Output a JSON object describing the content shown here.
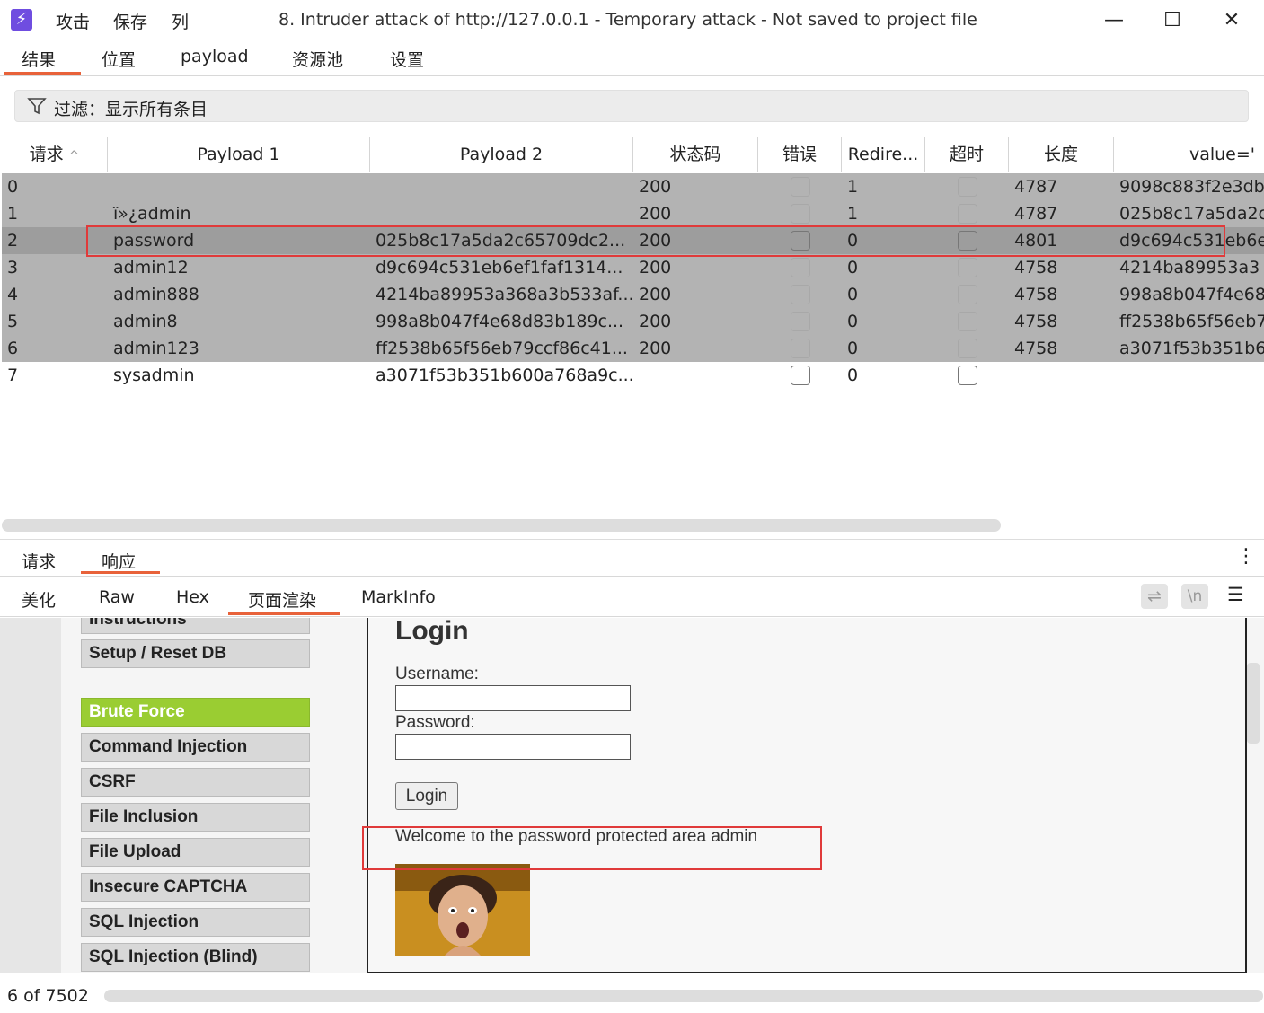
{
  "window": {
    "title": "8. Intruder attack of http://127.0.0.1 - Temporary attack - Not saved to project file",
    "menu": [
      "攻击",
      "保存",
      "列"
    ],
    "controls": {
      "minimize": "—",
      "maximize": "☐",
      "close": "✕"
    }
  },
  "top_tabs": [
    "结果",
    "位置",
    "payload",
    "资源池",
    "设置"
  ],
  "filter": {
    "label": "过滤：显示所有条目"
  },
  "table": {
    "headers": [
      "请求",
      "Payload 1",
      "Payload 2",
      "状态码",
      "错误",
      "Redire...",
      "超时",
      "长度",
      "value='"
    ],
    "sort_indicator": "^",
    "rows": [
      {
        "req": "0",
        "p1": "",
        "p2": "",
        "status": "200",
        "redir": "1",
        "len": "4787",
        "value": "9098c883f2e3db"
      },
      {
        "req": "1",
        "p1": "ï»¿admin",
        "p2": "",
        "status": "200",
        "redir": "1",
        "len": "4787",
        "value": "025b8c17a5da2c"
      },
      {
        "req": "2",
        "p1": "password",
        "p2": "025b8c17a5da2c65709dc2...",
        "status": "200",
        "redir": "0",
        "len": "4801",
        "value": "d9c694c531eb6e"
      },
      {
        "req": "3",
        "p1": "admin12",
        "p2": "d9c694c531eb6ef1faf1314...",
        "status": "200",
        "redir": "0",
        "len": "4758",
        "value": "4214ba89953a3"
      },
      {
        "req": "4",
        "p1": "admin888",
        "p2": "4214ba89953a368a3b533af...",
        "status": "200",
        "redir": "0",
        "len": "4758",
        "value": "998a8b047f4e68"
      },
      {
        "req": "5",
        "p1": "admin8",
        "p2": "998a8b047f4e68d83b189c...",
        "status": "200",
        "redir": "0",
        "len": "4758",
        "value": "ff2538b65f56eb7"
      },
      {
        "req": "6",
        "p1": "admin123",
        "p2": "ff2538b65f56eb79ccf86c41...",
        "status": "200",
        "redir": "0",
        "len": "4758",
        "value": "a3071f53b351b6"
      },
      {
        "req": "7",
        "p1": "sysadmin",
        "p2": "a3071f53b351b600a768a9c...",
        "status": "",
        "redir": "0",
        "len": "",
        "value": ""
      }
    ]
  },
  "req_resp_tabs": [
    "请求",
    "响应"
  ],
  "view_tabs": [
    "美化",
    "Raw",
    "Hex",
    "页面渲染",
    "MarkInfo"
  ],
  "view_icons": {
    "wrap": "⇌",
    "newline": "\\n",
    "menu": "☰",
    "more": "⋮"
  },
  "render": {
    "nav": [
      "Instructions",
      "Setup / Reset DB",
      "Brute Force",
      "Command Injection",
      "CSRF",
      "File Inclusion",
      "File Upload",
      "Insecure CAPTCHA",
      "SQL Injection",
      "SQL Injection (Blind)"
    ],
    "heading": "Login",
    "username_label": "Username:",
    "password_label": "Password:",
    "login_button": "Login",
    "welcome": "Welcome to the password protected area admin",
    "active_color": "#9acd32"
  },
  "status": {
    "text": "6 of 7502"
  }
}
